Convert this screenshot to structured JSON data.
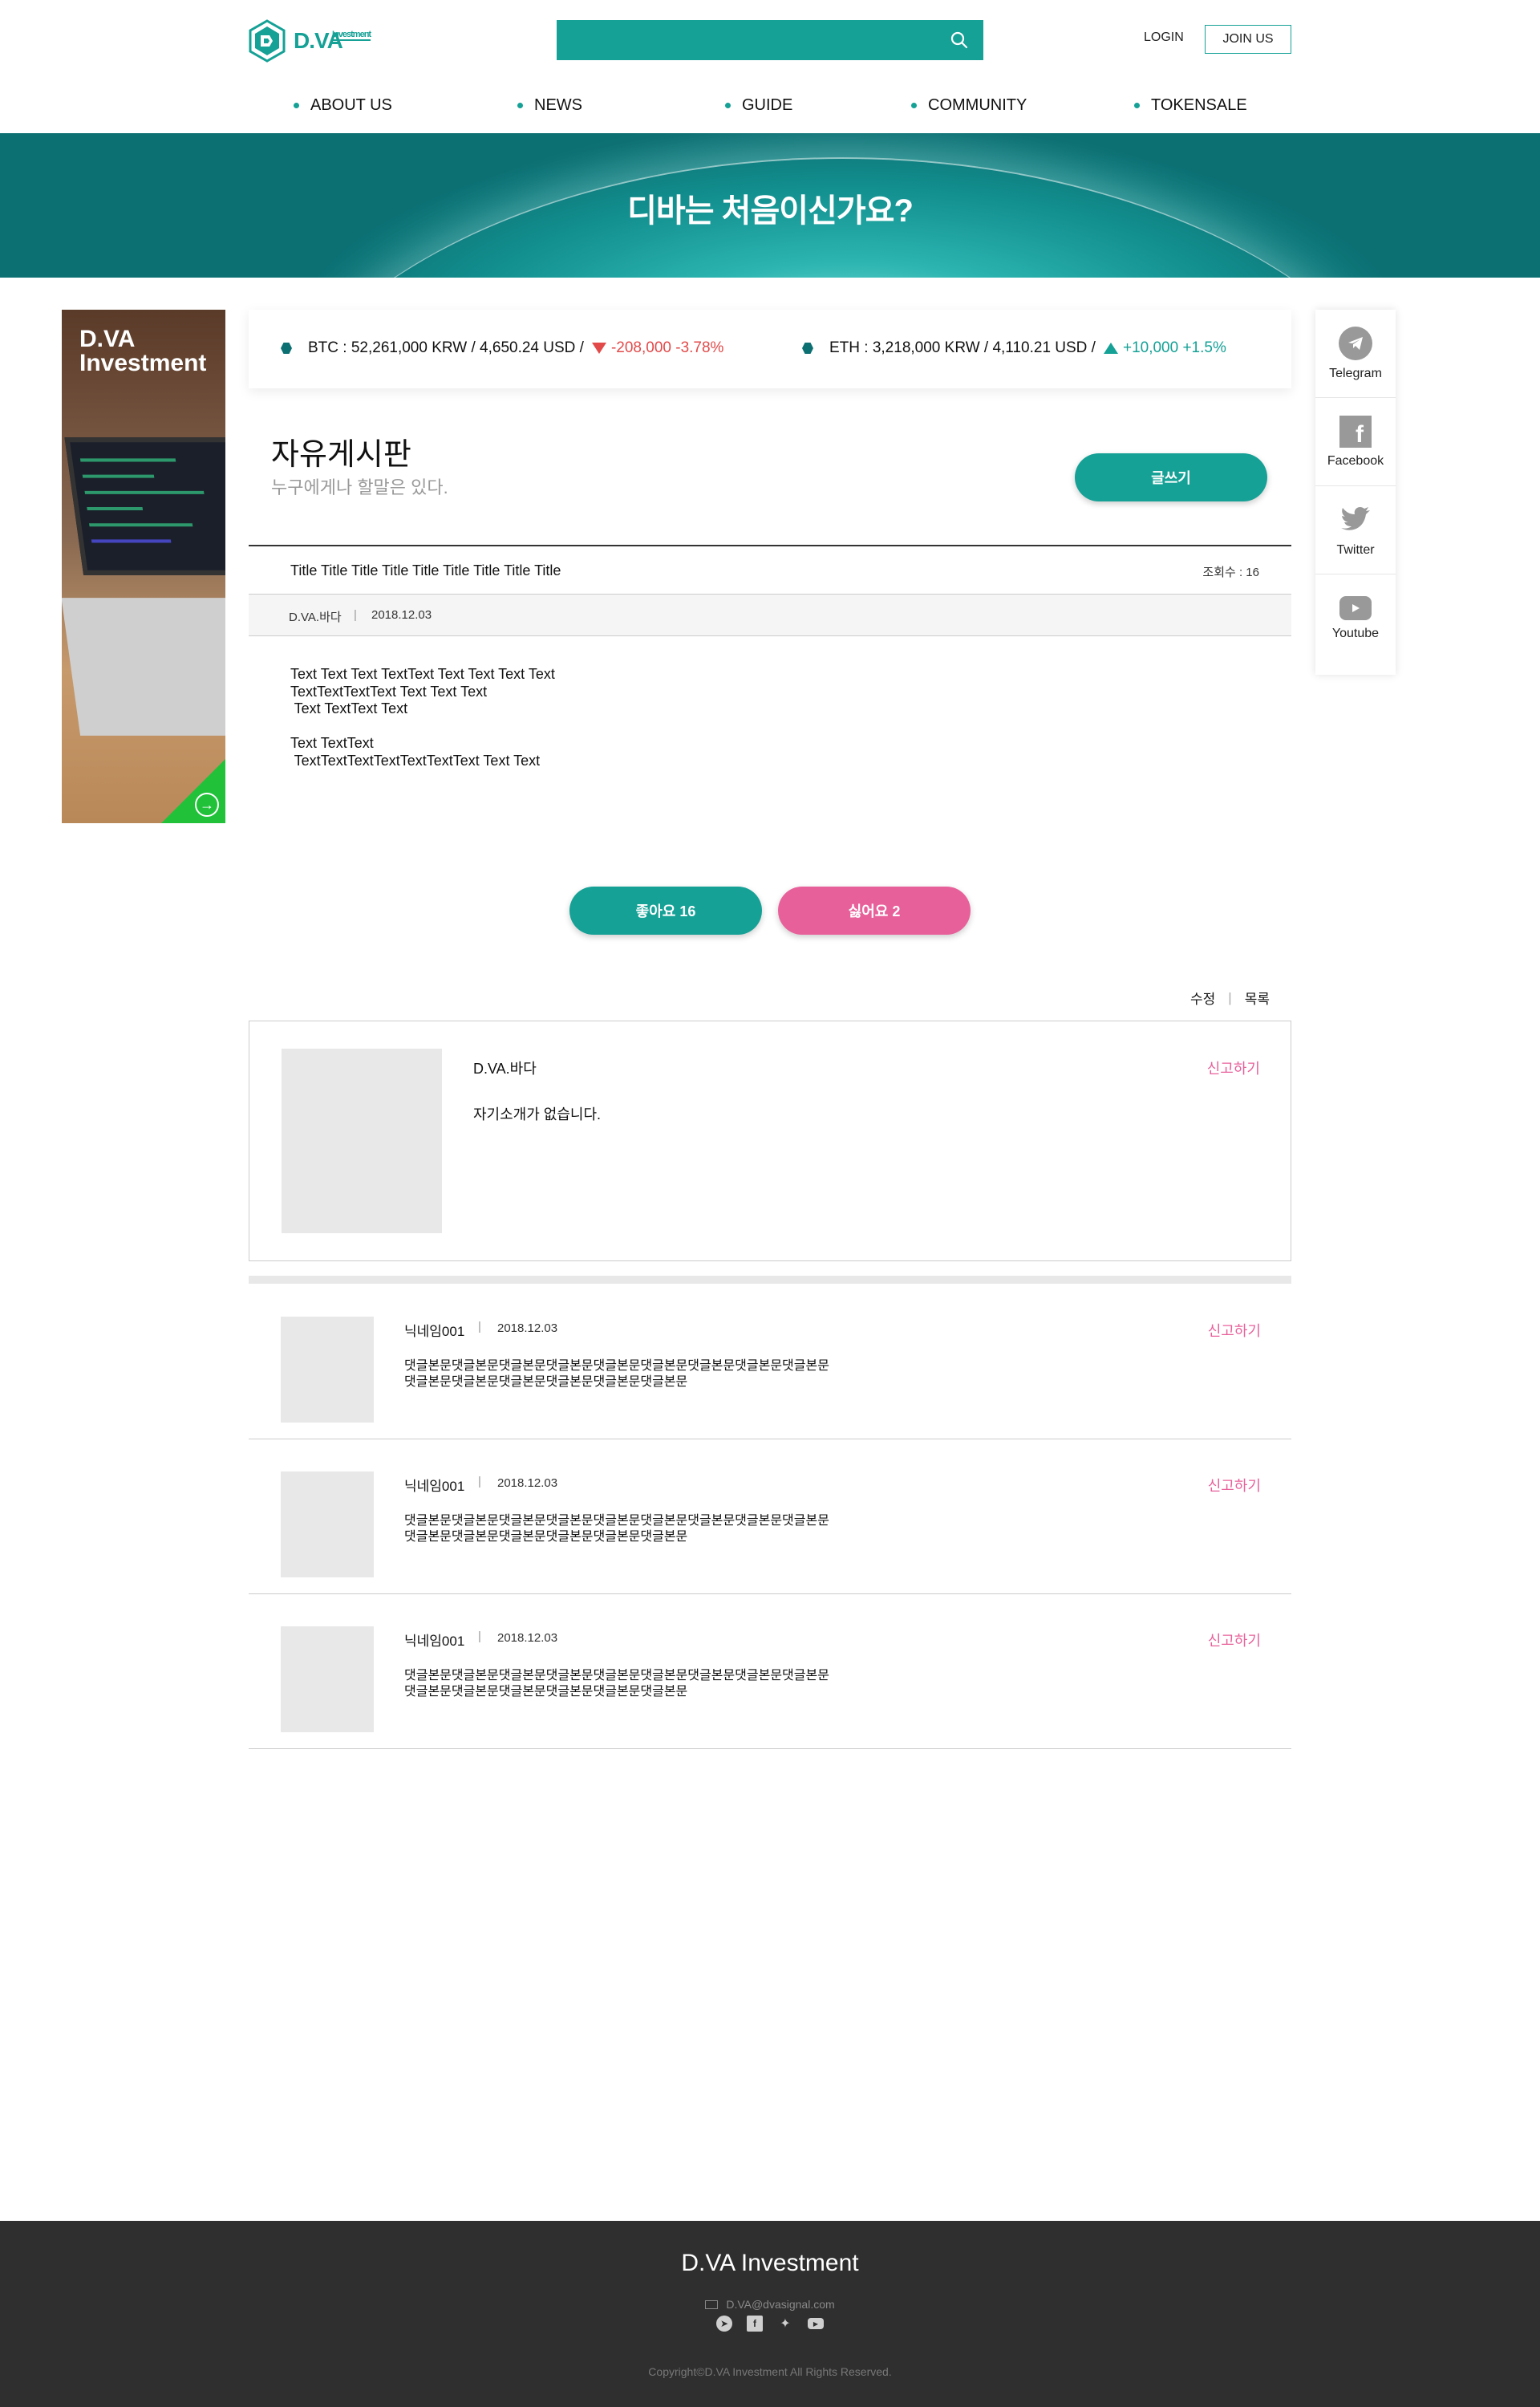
{
  "header": {
    "logo_text": "D.VA",
    "logo_sub": "Investment",
    "login_label": "LOGIN",
    "join_label": "JOIN US"
  },
  "nav": [
    {
      "label": "ABOUT US"
    },
    {
      "label": "NEWS"
    },
    {
      "label": "GUIDE"
    },
    {
      "label": "COMMUNITY"
    },
    {
      "label": "TOKENSALE"
    }
  ],
  "hero": {
    "title": "디바는 처음이신가요?"
  },
  "ad": {
    "title_line1": "D.VA",
    "title_line2": "Investment"
  },
  "ticker": {
    "btc": {
      "text": "BTC : 52,261,000 KRW / 4,650.24 USD /",
      "change": "-208,000 -3.78%",
      "direction": "down"
    },
    "eth": {
      "text": "ETH : 3,218,000 KRW / 4,110.21 USD /",
      "change": "+10,000 +1.5%",
      "direction": "up"
    }
  },
  "social": [
    {
      "label": "Telegram",
      "icon": "telegram-icon"
    },
    {
      "label": "Facebook",
      "icon": "facebook-icon"
    },
    {
      "label": "Twitter",
      "icon": "twitter-icon"
    },
    {
      "label": "Youtube",
      "icon": "youtube-icon"
    }
  ],
  "board": {
    "title": "자유게시판",
    "subtitle": "누구에게나 할말은 있다.",
    "write_label": "글쓰기"
  },
  "post": {
    "title": "Title Title Title Title Title Title Title Title Title",
    "views": "조회수 : 16",
    "author": "D.VA.바다",
    "date": "2018.12.03",
    "body": "Text Text Text TextText Text Text Text Text\nTextTextTextText Text Text Text\n Text TextText Text\n\nText TextText\n TextTextTextTextTextTextText Text Text",
    "like_label": "좋아요 16",
    "dislike_label": "싫어요 2",
    "edit_label": "수정",
    "list_label": "목록"
  },
  "author_card": {
    "name": "D.VA.바다",
    "bio": "자기소개가 없습니다.",
    "report_label": "신고하기"
  },
  "comments": [
    {
      "name": "닉네임001",
      "date": "2018.12.03",
      "text": "댓글본문댓글본문댓글본문댓글본문댓글본문댓글본문댓글본문댓글본문댓글본문\n댓글본문댓글본문댓글본문댓글본문댓글본문댓글본문",
      "report_label": "신고하기"
    },
    {
      "name": "닉네임001",
      "date": "2018.12.03",
      "text": "댓글본문댓글본문댓글본문댓글본문댓글본문댓글본문댓글본문댓글본문댓글본문\n댓글본문댓글본문댓글본문댓글본문댓글본문댓글본문",
      "report_label": "신고하기"
    },
    {
      "name": "닉네임001",
      "date": "2018.12.03",
      "text": "댓글본문댓글본문댓글본문댓글본문댓글본문댓글본문댓글본문댓글본문댓글본문\n댓글본문댓글본문댓글본문댓글본문댓글본문댓글본문",
      "report_label": "신고하기"
    }
  ],
  "footer": {
    "title": "D.VA Investment",
    "email": "D.VA@dvasignal.com",
    "copyright": "Copyright©D.VA Investment All Rights Reserved."
  },
  "colors": {
    "accent": "#15a196",
    "pink": "#e8609a",
    "down": "#e24a4a",
    "footer_bg": "#2f2f2f"
  }
}
